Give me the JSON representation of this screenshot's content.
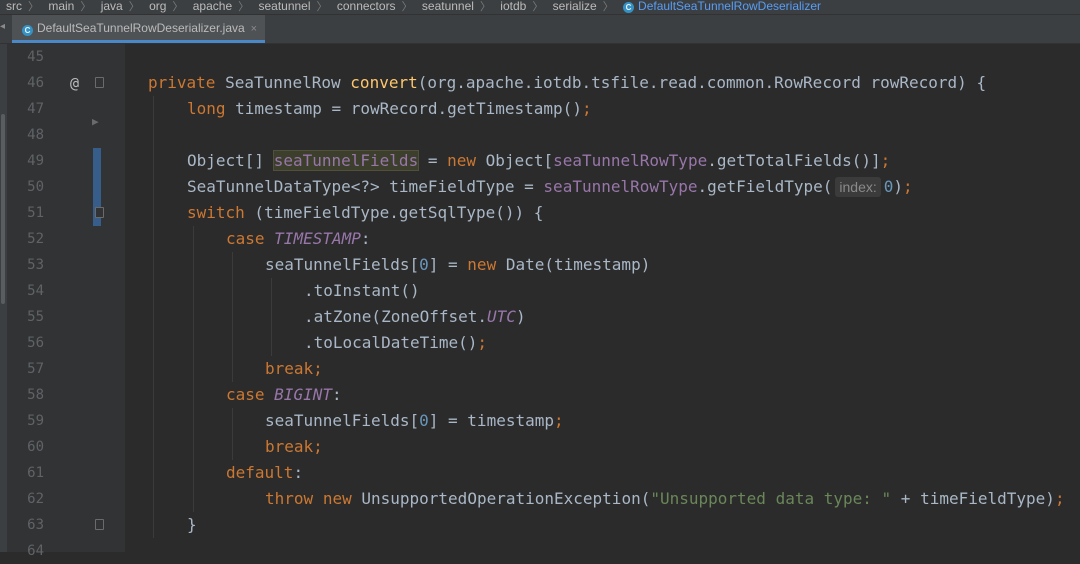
{
  "breadcrumb": {
    "items": [
      "src",
      "main",
      "java",
      "org",
      "apache",
      "seatunnel",
      "connectors",
      "seatunnel",
      "iotdb",
      "serialize"
    ],
    "current": "DefaultSeaTunnelRowDeserializer"
  },
  "tab": {
    "label": "DefaultSeaTunnelRowDeserializer.java",
    "close_icon": "×"
  },
  "lines": [
    {
      "n": "45"
    },
    {
      "n": "46"
    },
    {
      "n": "47"
    },
    {
      "n": "48"
    },
    {
      "n": "49"
    },
    {
      "n": "50"
    },
    {
      "n": "51"
    },
    {
      "n": "52"
    },
    {
      "n": "53"
    },
    {
      "n": "54"
    },
    {
      "n": "55"
    },
    {
      "n": "56"
    },
    {
      "n": "57"
    },
    {
      "n": "58"
    },
    {
      "n": "59"
    },
    {
      "n": "60"
    },
    {
      "n": "61"
    },
    {
      "n": "62"
    },
    {
      "n": "63"
    },
    {
      "n": "64"
    }
  ],
  "code": {
    "l46": {
      "mod": "private",
      "type": " SeaTunnelRow ",
      "name": "convert",
      "rest": "(org.apache.iotdb.tsfile.read.common.RowRecord rowRecord) {"
    },
    "l47": {
      "kw": "long",
      "rest": " timestamp = rowRecord.getTimestamp()",
      "semi": ";"
    },
    "l49": {
      "a": "Object[] ",
      "hl": "seaTunnelFields",
      "b": " = ",
      "kw": "new",
      "c": " Object[",
      "field": "seaTunnelRowType",
      "d": ".getTotalFields()]",
      "semi": ";"
    },
    "l50": {
      "a": "SeaTunnelDataType<?> timeFieldType = ",
      "field": "seaTunnelRowType",
      "b": ".getFieldType(",
      "hint": "index:",
      "num": "0",
      "c": ")",
      "semi": ";"
    },
    "l51": {
      "kw": "switch",
      "rest": " (timeFieldType.getSqlType()) {"
    },
    "l52": {
      "kw": "case",
      "cnst": "TIMESTAMP",
      "rest": ":"
    },
    "l53": {
      "a": "seaTunnelFields[",
      "num": "0",
      "b": "] = ",
      "kw": "new",
      "c": " Date(timestamp)"
    },
    "l54": {
      "a": ".toInstant()"
    },
    "l55": {
      "a": ".atZone(ZoneOffset.",
      "cnst": "UTC",
      "b": ")"
    },
    "l56": {
      "a": ".toLocalDateTime()",
      "semi": ";"
    },
    "l57": {
      "kw": "break",
      "semi": ";"
    },
    "l58": {
      "kw": "case",
      "cnst": "BIGINT",
      "rest": ":"
    },
    "l59": {
      "a": "seaTunnelFields[",
      "num": "0",
      "b": "] = timestamp",
      "semi": ";"
    },
    "l60": {
      "kw": "break",
      "semi": ";"
    },
    "l61": {
      "kw": "default",
      "rest": ":"
    },
    "l62": {
      "kw1": "throw",
      "kw2": "new",
      "a": " UnsupportedOperationException(",
      "str": "\"Unsupported data type: \"",
      "b": " + timeFieldType)",
      "semi": ";"
    },
    "l63": {
      "a": "}"
    }
  },
  "gutter": {
    "override_marker": "@"
  },
  "colors": {
    "background": "#2b2b2b",
    "keyword": "#cc7832",
    "method": "#ffc66d",
    "field": "#9876aa",
    "string": "#6a8759",
    "number": "#6897bb",
    "text": "#a9b7c6",
    "accent": "#4a88c7"
  }
}
